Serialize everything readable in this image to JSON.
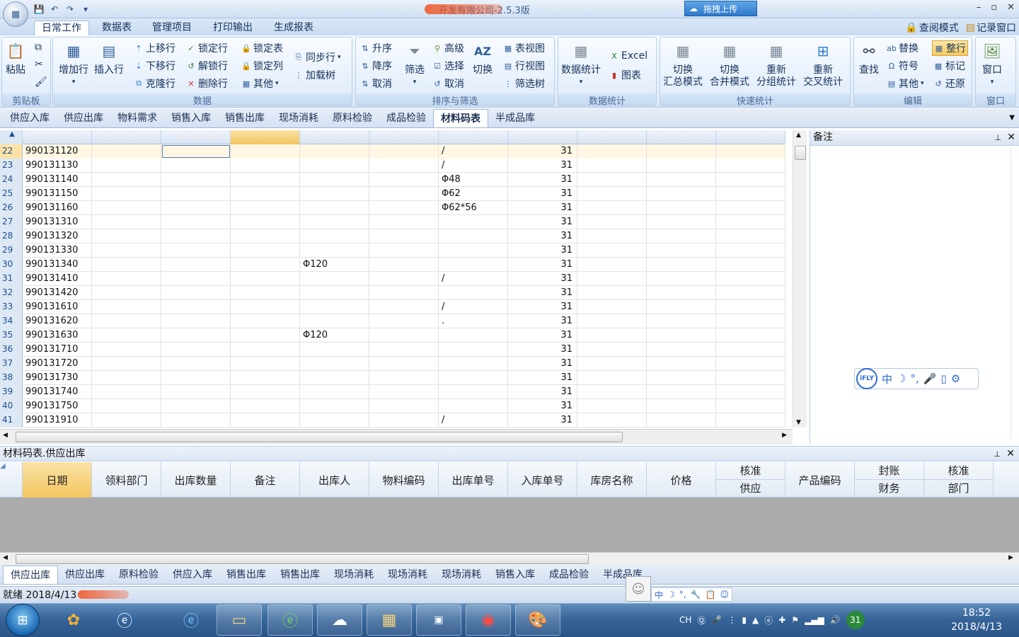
{
  "window": {
    "title": "开发有限公司-2.5.3版",
    "upload_label": "拖拽上传",
    "controls": [
      "–",
      "▫",
      "✕"
    ]
  },
  "ribbon_tabs": [
    "日常工作",
    "数据表",
    "管理项目",
    "打印输出",
    "生成报表"
  ],
  "mode_links": [
    "查阅模式",
    "记录窗口"
  ],
  "ribbon": {
    "clipboard": {
      "label": "剪贴板",
      "paste": "粘贴"
    },
    "data": {
      "label": "数据",
      "add_row": "增加行",
      "insert_row": "插入行",
      "move_up": "上移行",
      "move_down": "下移行",
      "clone_row": "克隆行",
      "lock_row": "锁定行",
      "unlock_row": "解锁行",
      "delete_row": "删除行",
      "lock_table": "锁定表",
      "lock_col": "锁定列",
      "other": "其他",
      "sync_row": "同步行",
      "load_tree": "加载树"
    },
    "sort_filter": {
      "label": "排序与筛选",
      "asc": "升序",
      "desc": "降序",
      "cancel": "取消",
      "filter": "筛选",
      "advanced": "高级",
      "select": "选择",
      "cancel2": "取消",
      "switch": "切换",
      "table_view": "表视图",
      "row_view": "行视图",
      "filter_tree": "筛选树"
    },
    "stats": {
      "label": "数据统计",
      "data_stats": "数据统计",
      "excel": "Excel",
      "chart": "图表"
    },
    "quick_stats": {
      "label": "快速统计",
      "b1": [
        "切换",
        "汇总模式"
      ],
      "b2": [
        "切换",
        "合并模式"
      ],
      "b3": [
        "重新",
        "分组统计"
      ],
      "b4": [
        "重新",
        "交叉统计"
      ]
    },
    "edit": {
      "label": "编辑",
      "find": "查找",
      "replace": "替换",
      "symbol": "符号",
      "other": "其他",
      "whole_row": "整行",
      "mark": "标记",
      "restore": "还原"
    },
    "window": {
      "label": "窗口",
      "window": "窗口"
    }
  },
  "sheet_tabs": [
    "供应入库",
    "供应出库",
    "物料需求",
    "销售入库",
    "销售出库",
    "现场消耗",
    "原料检验",
    "成品检验",
    "材料码表",
    "半成品库"
  ],
  "active_sheet": "材料码表",
  "grid_rows": [
    {
      "n": "22",
      "code": "990131120",
      "c5": "",
      "c7": "/",
      "num": "31"
    },
    {
      "n": "23",
      "code": "990131130",
      "c5": "",
      "c7": "/",
      "num": "31"
    },
    {
      "n": "24",
      "code": "990131140",
      "c5": "",
      "c7": "Φ48",
      "num": "31"
    },
    {
      "n": "25",
      "code": "990131150",
      "c5": "",
      "c7": "Φ62",
      "num": "31"
    },
    {
      "n": "26",
      "code": "990131160",
      "c5": "",
      "c7": "Φ62*56",
      "num": "31"
    },
    {
      "n": "27",
      "code": "990131310",
      "c5": "",
      "c7": "",
      "num": "31"
    },
    {
      "n": "28",
      "code": "990131320",
      "c5": "",
      "c7": "",
      "num": "31"
    },
    {
      "n": "29",
      "code": "990131330",
      "c5": "",
      "c7": "",
      "num": "31"
    },
    {
      "n": "30",
      "code": "990131340",
      "c5": "Φ120",
      "c7": "",
      "num": "31"
    },
    {
      "n": "31",
      "code": "990131410",
      "c5": "",
      "c7": "/",
      "num": "31"
    },
    {
      "n": "32",
      "code": "990131420",
      "c5": "",
      "c7": "",
      "num": "31"
    },
    {
      "n": "33",
      "code": "990131610",
      "c5": "",
      "c7": "/",
      "num": "31"
    },
    {
      "n": "34",
      "code": "990131620",
      "c5": "",
      "c7": ".",
      "num": "31"
    },
    {
      "n": "35",
      "code": "990131630",
      "c5": "Φ120",
      "c7": "",
      "num": "31"
    },
    {
      "n": "36",
      "code": "990131710",
      "c5": "",
      "c7": "",
      "num": "31"
    },
    {
      "n": "37",
      "code": "990131720",
      "c5": "",
      "c7": "",
      "num": "31"
    },
    {
      "n": "38",
      "code": "990131730",
      "c5": "",
      "c7": "",
      "num": "31"
    },
    {
      "n": "39",
      "code": "990131740",
      "c5": "",
      "c7": "",
      "num": "31"
    },
    {
      "n": "40",
      "code": "990131750",
      "c5": "",
      "c7": "",
      "num": "31"
    },
    {
      "n": "41",
      "code": "990131910",
      "c5": "",
      "c7": "/",
      "num": "31"
    }
  ],
  "notes_pane": {
    "title": "备注"
  },
  "ifly_toolbar": {
    "logo": "iFLY",
    "lang": "中",
    "tools": [
      "☽",
      "°,",
      "🎤",
      "▯",
      "⚙"
    ]
  },
  "lower_pane": {
    "title": "材料码表.供应出库",
    "headers": [
      "日期",
      "领料部门",
      "出库数量",
      "备注",
      "出库人",
      "物料编码",
      "出库单号",
      "入库单号",
      "库房名称",
      "价格"
    ],
    "header_pair_1": [
      "核准",
      "供应"
    ],
    "header_product": "产品编码",
    "header_pair_2": [
      "封账",
      "财务"
    ],
    "header_pair_3": [
      "核准",
      "部门"
    ]
  },
  "bottom_tabs": [
    "供应出库",
    "供应出库",
    "原料检验",
    "供应入库",
    "销售出库",
    "销售出库",
    "现场消耗",
    "现场消耗",
    "现场消耗",
    "销售入库",
    "成品检验",
    "半成品库"
  ],
  "status": {
    "text": "就绪 2018/4/13"
  },
  "ime": {
    "lang": "中",
    "tools": [
      "☽",
      "°,",
      "🔧",
      "📋",
      "☺"
    ]
  },
  "taskbar": {
    "tray_lang": "CH",
    "clock_time": "18:52",
    "clock_date": "2018/4/13",
    "calendar_day": "31"
  }
}
